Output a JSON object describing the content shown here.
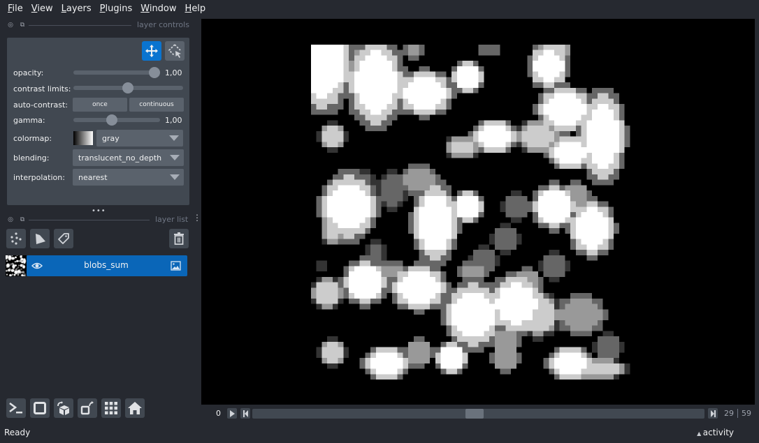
{
  "menu": [
    {
      "label": "File",
      "accel": "F",
      "rest": "ile"
    },
    {
      "label": "View",
      "accel": "V",
      "rest": "iew"
    },
    {
      "label": "Layers",
      "accel": "L",
      "rest": "ayers"
    },
    {
      "label": "Plugins",
      "accel": "P",
      "rest": "lugins"
    },
    {
      "label": "Window",
      "accel": "W",
      "rest": "indow"
    },
    {
      "label": "Help",
      "accel": "H",
      "rest": "elp"
    }
  ],
  "layer_controls": {
    "title": "layer controls",
    "opacity": {
      "label": "opacity:",
      "value": 1.0,
      "value_text": "1,00"
    },
    "contrast_limits": {
      "label": "contrast limits:",
      "handle_fraction": 0.5
    },
    "auto_contrast": {
      "label": "auto-contrast:",
      "once": "once",
      "continuous": "continuous"
    },
    "gamma": {
      "label": "gamma:",
      "value": 1.0,
      "value_text": "1,00",
      "handle_fraction": 0.5
    },
    "colormap": {
      "label": "colormap:",
      "value": "gray"
    },
    "blending": {
      "label": "blending:",
      "value": "translucent_no_depth"
    },
    "interpolation": {
      "label": "interpolation:",
      "value": "nearest"
    }
  },
  "layer_list": {
    "title": "layer list",
    "layers": [
      {
        "name": "blobs_sum",
        "visible": true,
        "type": "image",
        "selected": true
      }
    ]
  },
  "dims": {
    "current": 29,
    "max": 59,
    "min_label": "0",
    "current_label": "29",
    "max_label": "59"
  },
  "status": {
    "text": "Ready",
    "activity_label": "activity"
  },
  "colors": {
    "accent": "#0a74d0",
    "selected_layer": "#0a66b8",
    "background": "#262930",
    "panel": "#414851"
  },
  "image": {
    "cols": 60,
    "rows": 62,
    "levels": [
      0,
      51,
      102,
      153,
      204,
      255
    ],
    "blobs": [
      [
        2,
        3,
        5.5,
        9,
        5
      ],
      [
        3,
        1,
        4,
        6,
        5
      ],
      [
        12,
        7,
        5,
        8,
        5
      ],
      [
        11,
        4,
        4,
        4,
        4
      ],
      [
        21,
        9,
        5,
        4,
        5
      ],
      [
        29,
        6,
        3,
        3,
        5
      ],
      [
        19,
        1,
        2,
        2,
        3
      ],
      [
        33,
        1,
        3,
        1,
        2
      ],
      [
        44,
        4,
        3.5,
        4,
        5
      ],
      [
        45,
        1,
        3,
        3,
        4
      ],
      [
        47,
        12,
        5,
        4,
        5
      ],
      [
        54,
        17,
        4,
        8,
        5
      ],
      [
        48,
        20,
        4,
        3,
        5
      ],
      [
        42,
        17,
        4,
        3,
        4
      ],
      [
        34,
        17,
        4,
        3,
        5
      ],
      [
        28,
        19,
        3,
        2,
        4
      ],
      [
        4,
        17,
        2.5,
        2.5,
        4
      ],
      [
        7,
        30,
        5,
        6,
        5
      ],
      [
        4,
        34,
        2,
        3,
        4
      ],
      [
        23,
        33,
        4,
        7,
        5
      ],
      [
        29,
        30,
        3,
        3,
        5
      ],
      [
        20,
        25,
        4,
        3,
        3
      ],
      [
        15,
        27,
        3,
        4,
        2
      ],
      [
        10,
        26,
        2,
        3,
        2
      ],
      [
        45,
        30,
        4,
        4,
        5
      ],
      [
        52,
        34,
        4,
        5,
        5
      ],
      [
        49,
        28,
        3,
        3,
        3
      ],
      [
        38,
        30,
        3,
        3,
        2
      ],
      [
        36,
        36,
        3,
        3,
        2
      ],
      [
        10,
        44,
        4,
        4,
        5
      ],
      [
        20,
        45,
        5,
        4,
        5
      ],
      [
        15,
        42,
        3,
        2,
        3
      ],
      [
        3,
        46,
        3,
        3,
        4
      ],
      [
        30,
        50,
        5,
        6,
        5
      ],
      [
        38,
        48,
        5,
        5,
        5
      ],
      [
        36,
        55,
        3,
        3,
        3
      ],
      [
        42,
        50,
        4,
        4,
        4
      ],
      [
        50,
        50,
        5,
        4,
        3
      ],
      [
        55,
        56,
        3,
        3,
        2
      ],
      [
        4,
        57,
        2.5,
        2.5,
        4
      ],
      [
        14,
        59,
        4,
        3,
        5
      ],
      [
        26,
        58,
        3,
        3,
        5
      ],
      [
        20,
        57,
        3,
        3,
        3
      ],
      [
        36,
        58,
        3,
        3,
        3
      ],
      [
        48,
        59,
        4,
        3,
        5
      ],
      [
        53,
        60,
        5,
        2,
        4
      ],
      [
        24,
        36,
        3,
        4,
        2
      ],
      [
        32,
        40,
        3,
        3,
        2
      ],
      [
        12,
        39,
        2,
        3,
        2
      ],
      [
        2,
        41,
        2,
        2,
        1
      ],
      [
        30,
        42,
        3,
        2,
        3
      ],
      [
        45,
        41,
        3,
        3,
        2
      ],
      [
        40,
        44,
        3,
        3,
        3
      ]
    ]
  }
}
